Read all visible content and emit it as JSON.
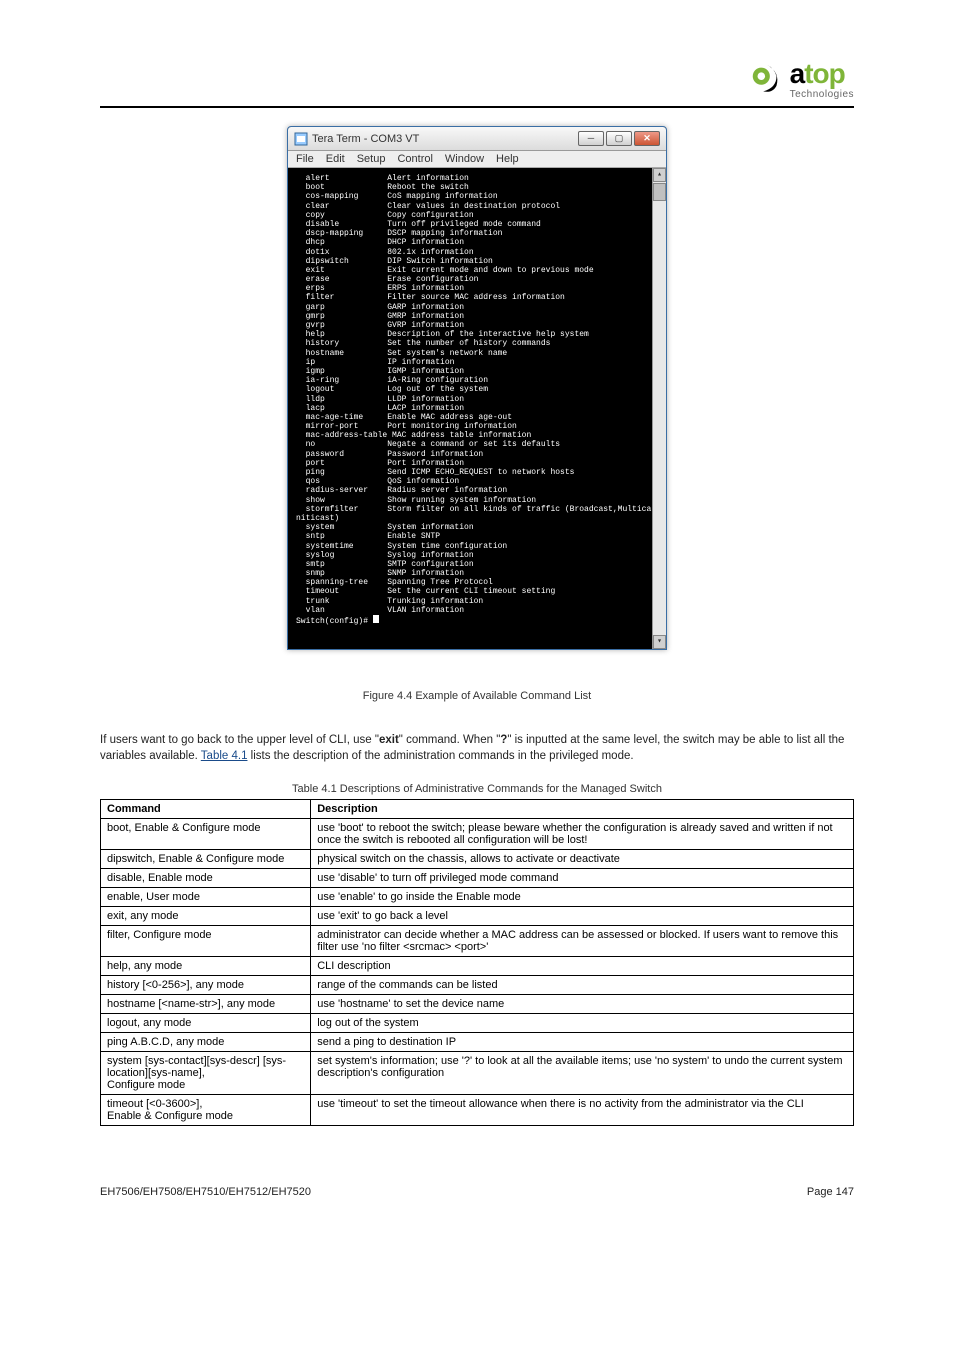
{
  "header": {
    "logo_main_black": "a",
    "logo_main_green": "top",
    "logo_sub": "Technologies"
  },
  "terminal": {
    "title": "Tera Term - COM3 VT",
    "menu": [
      "File",
      "Edit",
      "Setup",
      "Control",
      "Window",
      "Help"
    ],
    "lines": [
      "  alert            Alert information",
      "  boot             Reboot the switch",
      "  cos-mapping      CoS mapping information",
      "  clear            Clear values in destination protocol",
      "  copy             Copy configuration",
      "  disable          Turn off privileged mode command",
      "  dscp-mapping     DSCP mapping information",
      "  dhcp             DHCP information",
      "  dot1x            802.1x information",
      "  dipswitch        DIP Switch information",
      "  exit             Exit current mode and down to previous mode",
      "  erase            Erase configuration",
      "  erps             ERPS information",
      "  filter           Filter source MAC address information",
      "  garp             GARP information",
      "  gmrp             GMRP information",
      "  gvrp             GVRP information",
      "  help             Description of the interactive help system",
      "  history          Set the number of history commands",
      "  hostname         Set system's network name",
      "  ip               IP information",
      "  igmp             IGMP information",
      "  ia-ring          iA-Ring configuration",
      "  logout           Log out of the system",
      "  lldp             LLDP information",
      "  lacp             LACP information",
      "  mac-age-time     Enable MAC address age-out",
      "  mirror-port      Port monitoring information",
      "  mac-address-table MAC address table information",
      "  no               Negate a command or set its defaults",
      "  password         Password information",
      "  port             Port information",
      "  ping             Send ICMP ECHO_REQUEST to network hosts",
      "  qos              QoS information",
      "  radius-server    Radius server information",
      "  show             Show running system information",
      "  stormfilter      Storm filter on all kinds of traffic (Broadcast,Multicast,U",
      "niticast)",
      "  system           System information",
      "  sntp             Enable SNTP",
      "  systemtime       System time configuration",
      "  syslog           Syslog information",
      "  smtp             SMTP configuration",
      "  snmp             SNMP information",
      "  spanning-tree    Spanning Tree Protocol",
      "  timeout          Set the current CLI timeout setting",
      "  trunk            Trunking information",
      "  vlan             VLAN information"
    ],
    "prompt": "Switch(config)# "
  },
  "figure_caption": "Figure 4.4 Example of Available Command List",
  "paragraph": {
    "p1": "If users want to go back to the upper level of CLI, use \"",
    "exit": "exit",
    "p2": "\" command. When \"",
    "help": "?",
    "p3": "\" is inputted at the same level, the switch may be able to list all the variables available. ",
    "table_link": "Table 4.1",
    "p4": " lists the description of the administration commands in the privileged mode."
  },
  "table": {
    "caption": "Table 4.1 Descriptions of Administrative Commands for the Managed Switch",
    "headers": [
      "Command",
      "Description"
    ],
    "rows": [
      [
        "boot, Enable & Configure mode",
        "use 'boot' to reboot the switch; please beware whether the configuration is already saved and written if not once the switch is rebooted all configuration will be lost!"
      ],
      [
        "dipswitch, Enable & Configure mode",
        "physical switch on the chassis, allows to activate or deactivate"
      ],
      [
        "disable, Enable mode",
        "use 'disable' to turn off privileged mode command"
      ],
      [
        "enable, User mode",
        "use 'enable' to go inside the Enable mode"
      ],
      [
        "exit, any mode",
        "use 'exit' to go back a level"
      ],
      [
        "filter, Configure mode",
        "administrator can decide whether a MAC address can be assessed or blocked. If users want to remove this filter use 'no filter <srcmac> <port>'"
      ],
      [
        "help, any mode",
        "CLI description"
      ],
      [
        "history [<0-256>], any mode",
        "range of the commands can be listed"
      ],
      [
        "hostname [<name-str>], any mode",
        "use 'hostname' to set the device name"
      ],
      [
        "logout, any mode",
        "log out of the system"
      ],
      [
        "ping A.B.C.D, any mode",
        "send a ping to destination IP"
      ],
      [
        "system [sys-contact][sys-descr] [sys-location][sys-name],\nConfigure mode",
        "set system's information; use '?' to look at all the available items; use 'no system' to undo the current system description's configuration"
      ],
      [
        "timeout [<0-3600>],\nEnable & Configure mode",
        "use 'timeout' to set the timeout allowance when there is no activity from the administrator via the CLI"
      ]
    ]
  },
  "footer": {
    "left": "EH7506/EH7508/EH7510/EH7512/EH7520",
    "right": "Page 147"
  }
}
